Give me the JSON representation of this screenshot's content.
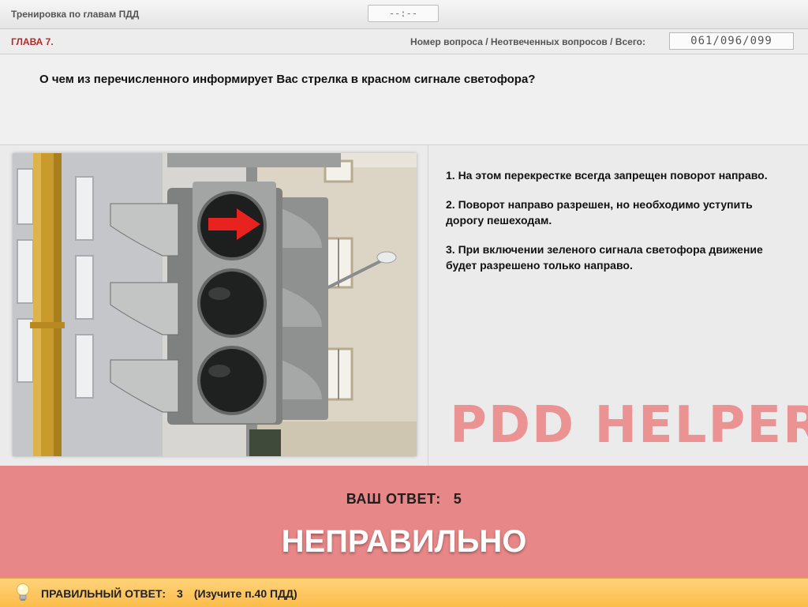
{
  "header": {
    "title": "Тренировка по главам ПДД",
    "timer": "--:--"
  },
  "infobar": {
    "chapter": "ГЛАВА 7.",
    "counter_label": "Номер вопроса / Неотвеченных вопросов / Всего:",
    "counter_value": "061/096/099"
  },
  "question": {
    "text": "О чем из перечисленного информирует Вас стрелка в красном сигнале светофора?"
  },
  "image": {
    "subject": "traffic-light-red-arrow-right-photo",
    "colors": {
      "arrow": "#e8231f",
      "housing": "#9a9d9c",
      "pole": "#c99b2c"
    }
  },
  "answers": [
    {
      "text": "1.  На этом перекрестке всегда запрещен поворот направо."
    },
    {
      "text": "2.  Поворот направо разрешен, но необходимо уступить дорогу пешеходам."
    },
    {
      "text": "3.  При включении зеленого сигнала светофора движение будет разрешено только направо."
    }
  ],
  "watermark": {
    "text": "PDD HELPER",
    "color": "#ec8c8c"
  },
  "result": {
    "your_answer_label": "ВАШ  ОТВЕТ:",
    "your_answer_value": "5",
    "verdict": "НЕПРАВИЛЬНО",
    "panel_color": "#e88787"
  },
  "hint": {
    "icon": "lightbulb-icon",
    "label": "ПРАВИЛЬНЫЙ ОТВЕТ:",
    "value": "3",
    "note": "(Изучите п.40 ПДД)",
    "bar_color": "#fbbd4a"
  }
}
